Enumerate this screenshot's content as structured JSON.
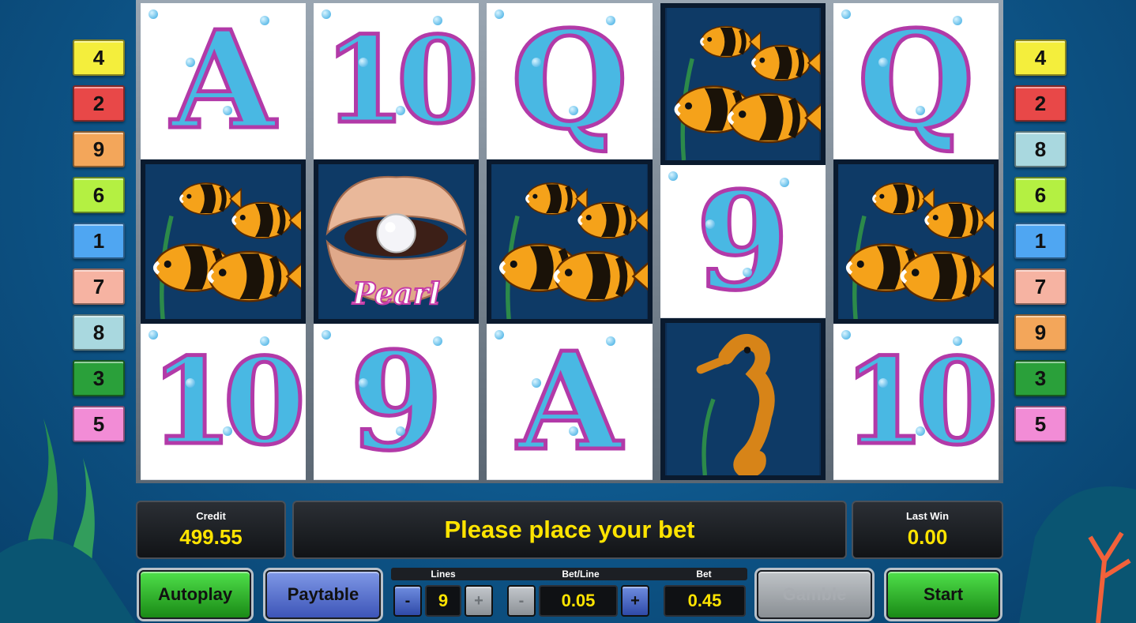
{
  "line_numbers": {
    "left": [
      {
        "n": "4",
        "color": "#f4ee3c"
      },
      {
        "n": "2",
        "color": "#e84848"
      },
      {
        "n": "9",
        "color": "#f3a65a"
      },
      {
        "n": "6",
        "color": "#b4f042"
      },
      {
        "n": "1",
        "color": "#4fa6f2"
      },
      {
        "n": "7",
        "color": "#f6b3a2"
      },
      {
        "n": "8",
        "color": "#a9d8df"
      },
      {
        "n": "3",
        "color": "#2aa03a"
      },
      {
        "n": "5",
        "color": "#f28cd6"
      }
    ],
    "right": [
      {
        "n": "4",
        "color": "#f4ee3c"
      },
      {
        "n": "2",
        "color": "#e84848"
      },
      {
        "n": "8",
        "color": "#a9d8df"
      },
      {
        "n": "6",
        "color": "#b4f042"
      },
      {
        "n": "1",
        "color": "#4fa6f2"
      },
      {
        "n": "7",
        "color": "#f6b3a2"
      },
      {
        "n": "9",
        "color": "#f3a65a"
      },
      {
        "n": "3",
        "color": "#2aa03a"
      },
      {
        "n": "5",
        "color": "#f28cd6"
      }
    ]
  },
  "reels": [
    [
      "A",
      "fish",
      "10"
    ],
    [
      "10",
      "pearl",
      "9"
    ],
    [
      "Q",
      "fish",
      "A"
    ],
    [
      "fish",
      "9",
      "seahorse"
    ],
    [
      "Q",
      "fish",
      "10"
    ]
  ],
  "pearl_label": "Pearl",
  "credit": {
    "label": "Credit",
    "value": "499.55"
  },
  "message": "Please place your bet",
  "last_win": {
    "label": "Last Win",
    "value": "0.00"
  },
  "buttons": {
    "autoplay": "Autoplay",
    "paytable": "Paytable",
    "gamble": "Gamble",
    "start": "Start"
  },
  "lines": {
    "label": "Lines",
    "value": "9",
    "minus": "-",
    "plus": "+"
  },
  "bet_line": {
    "label": "Bet/Line",
    "value": "0.05",
    "minus": "-",
    "plus": "+"
  },
  "bet": {
    "label": "Bet",
    "value": "0.45"
  },
  "colors": {
    "accent_yellow": "#ffe400",
    "symbol_blue": "#49b8e3",
    "symbol_outline": "#b23aa8"
  }
}
